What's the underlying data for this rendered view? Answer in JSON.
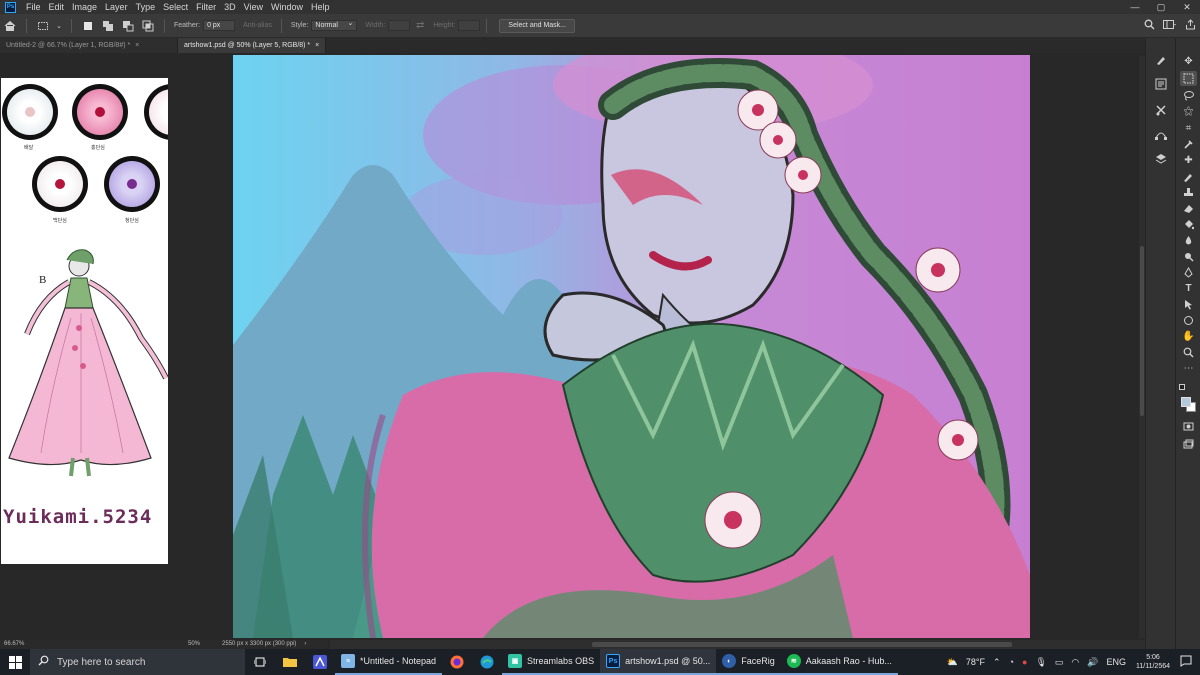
{
  "app": {
    "logo_text": "Ps",
    "menu": [
      "File",
      "Edit",
      "Image",
      "Layer",
      "Type",
      "Select",
      "Filter",
      "3D",
      "View",
      "Window",
      "Help"
    ],
    "window_controls": [
      "—",
      "▢",
      "✕"
    ]
  },
  "options": {
    "feather_label": "Feather:",
    "feather_value": "0 px",
    "antialias_label": "Anti-alias",
    "style_label": "Style:",
    "style_value": "Normal",
    "width_label": "Width:",
    "height_label": "Height:",
    "select_mask_label": "Select and Mask..."
  },
  "tabs": [
    {
      "label": "Untitled-2 @ 66.7% (Layer 1, RGB/8#) *",
      "close": "×"
    },
    {
      "label": "artshow1.psd @ 50% (Layer 5, RGB/8) *",
      "close": "×"
    }
  ],
  "left_doc": {
    "zoom": "66.67%",
    "captions": [
      "배달",
      "홍단심",
      "백단심",
      "청단심"
    ],
    "ref_letter": "B",
    "signature": "Yuikami.5234"
  },
  "main_doc": {
    "zoom": "50%",
    "dimensions": "2550 px x 3300 px (300 ppi)",
    "arrow": "›"
  },
  "colors": {
    "foreground": "#b6c8dc",
    "background": "#ffffff"
  },
  "taskbar": {
    "search_placeholder": "Type here to search",
    "apps": [
      {
        "label": "*Untitled - Notepad",
        "icon": "notepad-icon"
      },
      {
        "label": "Streamlabs OBS",
        "icon": "streamlabs-icon"
      },
      {
        "label": "artshow1.psd @ 50...",
        "icon": "photoshop-icon"
      },
      {
        "label": "FaceRig",
        "icon": "facerig-icon"
      },
      {
        "label": "Aakaash Rao - Hub...",
        "icon": "spotify-icon"
      }
    ],
    "weather": "78°F",
    "language": "ENG",
    "time": "5:06",
    "date": "11/11/2564"
  }
}
